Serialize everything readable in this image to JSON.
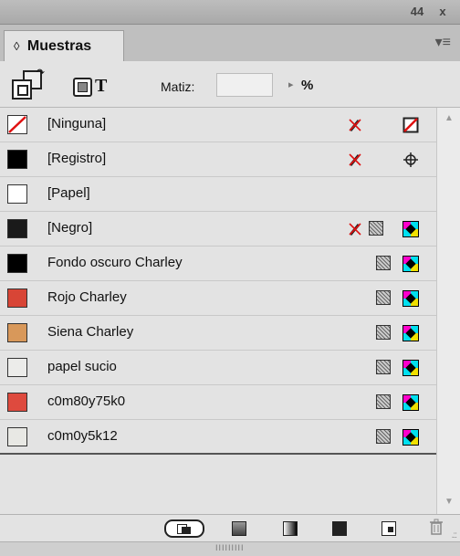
{
  "window": {
    "collapse_glyph": "44",
    "close_glyph": "x"
  },
  "panel": {
    "tab_label": "Muestras",
    "tab_arrows": "◊",
    "menu_glyph": "▾≡"
  },
  "toolbar": {
    "format_text_label": "T",
    "tint_label": "Matiz:",
    "tint_value": "",
    "tint_arrow": "▸",
    "tint_unit": "%"
  },
  "swatches": [
    {
      "name": "[Ninguna]",
      "color": "#ffffff",
      "kind": "none",
      "icons": [
        "no-edit-icon",
        "none-swatch-icon"
      ]
    },
    {
      "name": "[Registro]",
      "color": "#000000",
      "kind": "registration",
      "icons": [
        "no-edit-icon",
        "registration-icon"
      ]
    },
    {
      "name": "[Papel]",
      "color": "#ffffff",
      "kind": "paper",
      "icons": []
    },
    {
      "name": "[Negro]",
      "color": "#1a1a1a",
      "kind": "process",
      "icons": [
        "no-edit-icon",
        "process-color-icon",
        "cmyk-mode-icon"
      ]
    },
    {
      "name": "Fondo oscuro Charley",
      "color": "#000000",
      "kind": "process",
      "icons": [
        "process-color-icon",
        "cmyk-mode-icon"
      ]
    },
    {
      "name": "Rojo Charley",
      "color": "#d84536",
      "kind": "process",
      "icons": [
        "process-color-icon",
        "cmyk-mode-icon"
      ]
    },
    {
      "name": "Siena Charley",
      "color": "#d8985a",
      "kind": "process",
      "icons": [
        "process-color-icon",
        "cmyk-mode-icon"
      ]
    },
    {
      "name": "papel sucio",
      "color": "#ececea",
      "kind": "process",
      "icons": [
        "process-color-icon",
        "cmyk-mode-icon"
      ]
    },
    {
      "name": "c0m80y75k0",
      "color": "#de4a3e",
      "kind": "process",
      "icons": [
        "process-color-icon",
        "cmyk-mode-icon"
      ]
    },
    {
      "name": "c0m0y5k12",
      "color": "#e8e8e4",
      "kind": "process",
      "icons": [
        "process-color-icon",
        "cmyk-mode-icon"
      ]
    }
  ],
  "bottom_buttons": [
    "show-all-swatches-button",
    "show-color-swatches-button",
    "show-gradient-swatches-button",
    "show-solid-swatches-button",
    "new-swatch-button",
    "delete-swatch-button"
  ],
  "status": {
    "grip_dots": "IIIIIIIII"
  }
}
